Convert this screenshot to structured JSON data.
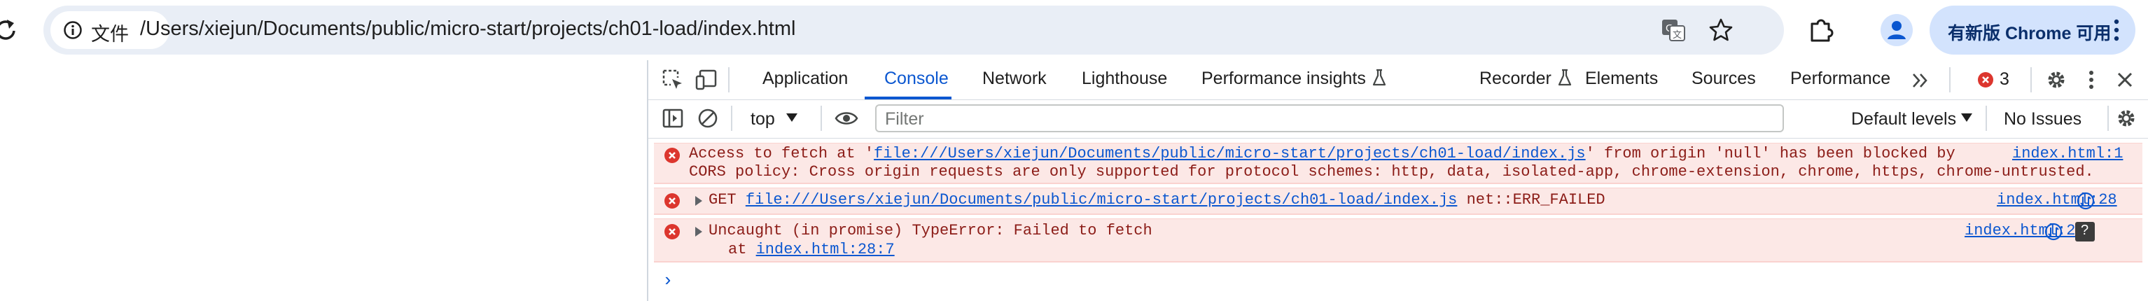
{
  "browser": {
    "site_chip_label": "文件",
    "url": "/Users/xiejun/Documents/public/micro-start/projects/ch01-load/index.html",
    "update_label": "有新版 Chrome 可用"
  },
  "devtools": {
    "tabs": [
      "Application",
      "Console",
      "Network",
      "Lighthouse",
      "Performance insights",
      "Recorder",
      "Elements",
      "Sources",
      "Performance"
    ],
    "active_tab": "Console",
    "error_count": "3",
    "context": "top",
    "filter_placeholder": "Filter",
    "levels": "Default levels",
    "issues": "No Issues"
  },
  "console": {
    "messages": [
      {
        "pre": "Access to fetch at '",
        "link": "file:///Users/xiejun/Documents/public/micro-start/projects/ch01-load/index.js",
        "post": "' from origin 'null' has been blocked by",
        "line2": "CORS policy: Cross origin requests are only supported for protocol schemes: http, data, isolated-app, chrome-extension, chrome, https, chrome-untrusted.",
        "source": "index.html:1"
      },
      {
        "method": "GET",
        "link": "file:///Users/xiejun/Documents/public/micro-start/projects/ch01-load/index.js",
        "post": "net::ERR_FAILED",
        "source": "index.html:28"
      },
      {
        "text": "Uncaught (in promise) TypeError: Failed to fetch",
        "at": "at",
        "at_link": "index.html:28:7",
        "source": "index.html:28"
      }
    ],
    "prompt": "›"
  },
  "colors": {
    "accent": "#0b57d0",
    "error_bg": "#fce8e6",
    "error_text": "#8c1d18",
    "error_icon": "#dc362e"
  }
}
